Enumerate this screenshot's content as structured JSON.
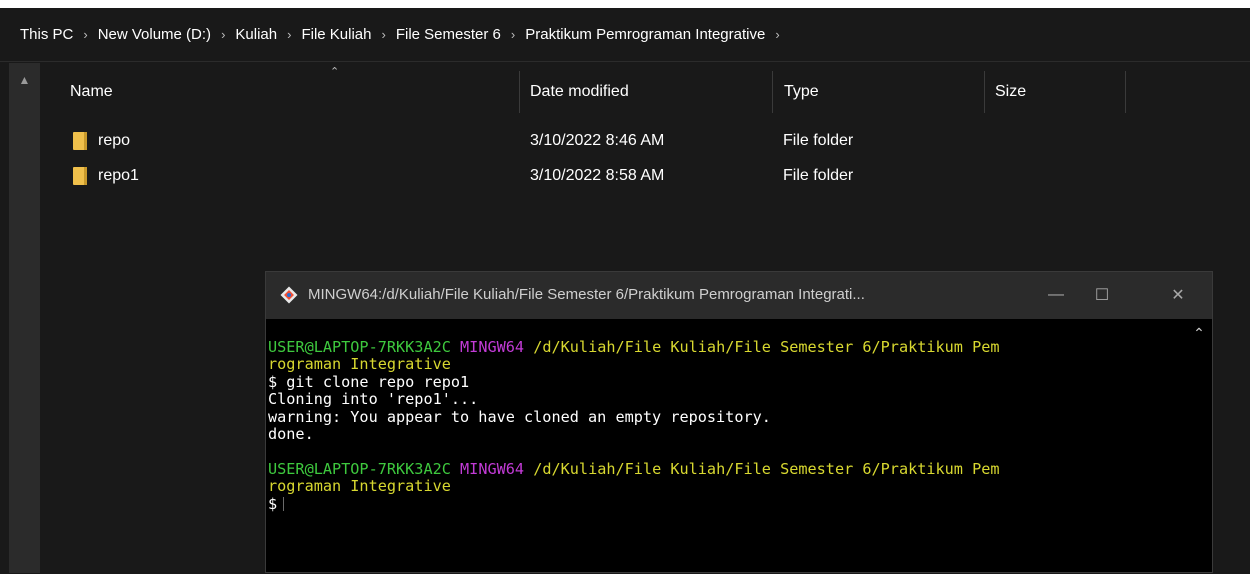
{
  "breadcrumb": [
    "This PC",
    "New Volume (D:)",
    "Kuliah",
    "File Kuliah",
    "File Semester 6",
    "Praktikum Pemrograman Integrative"
  ],
  "breadcrumb_separator": ">",
  "columns": {
    "name": "Name",
    "date_modified": "Date modified",
    "type": "Type",
    "size": "Size"
  },
  "files": [
    {
      "name": "repo",
      "date": "3/10/2022 8:46 AM",
      "type": "File folder"
    },
    {
      "name": "repo1",
      "date": "3/10/2022 8:58 AM",
      "type": "File folder"
    }
  ],
  "terminal": {
    "title": "MINGW64:/d/Kuliah/File Kuliah/File Semester 6/Praktikum Pemrograman Integrati...",
    "prompt1": {
      "user": "USER@LAPTOP-7RKK3A2C",
      "env": "MINGW64",
      "path": "/d/Kuliah/File Kuliah/File Semester 6/Praktikum Pem",
      "path_cont": "rograman Integrative"
    },
    "output": [
      "$ git clone repo repo1",
      "Cloning into 'repo1'...",
      "warning: You appear to have cloned an empty repository.",
      "done."
    ],
    "prompt2": {
      "user": "USER@LAPTOP-7RKK3A2C",
      "env": "MINGW64",
      "path": "/d/Kuliah/File Kuliah/File Semester 6/Praktikum Pem",
      "path_cont": "rograman Integrative"
    },
    "current_prompt": "$",
    "buttons": {
      "minimize": "—",
      "maximize": "☐",
      "close": "✕"
    }
  },
  "colors": {
    "user": "#3ec93e",
    "env": "#c23bd6",
    "path": "#d8d830",
    "folder": "#f0c04b"
  },
  "icons": [
    "chevron-right-icon",
    "folder-icon",
    "git-icon",
    "minimize-icon",
    "maximize-icon",
    "close-icon",
    "scroll-up-icon",
    "sort-up-icon"
  ]
}
